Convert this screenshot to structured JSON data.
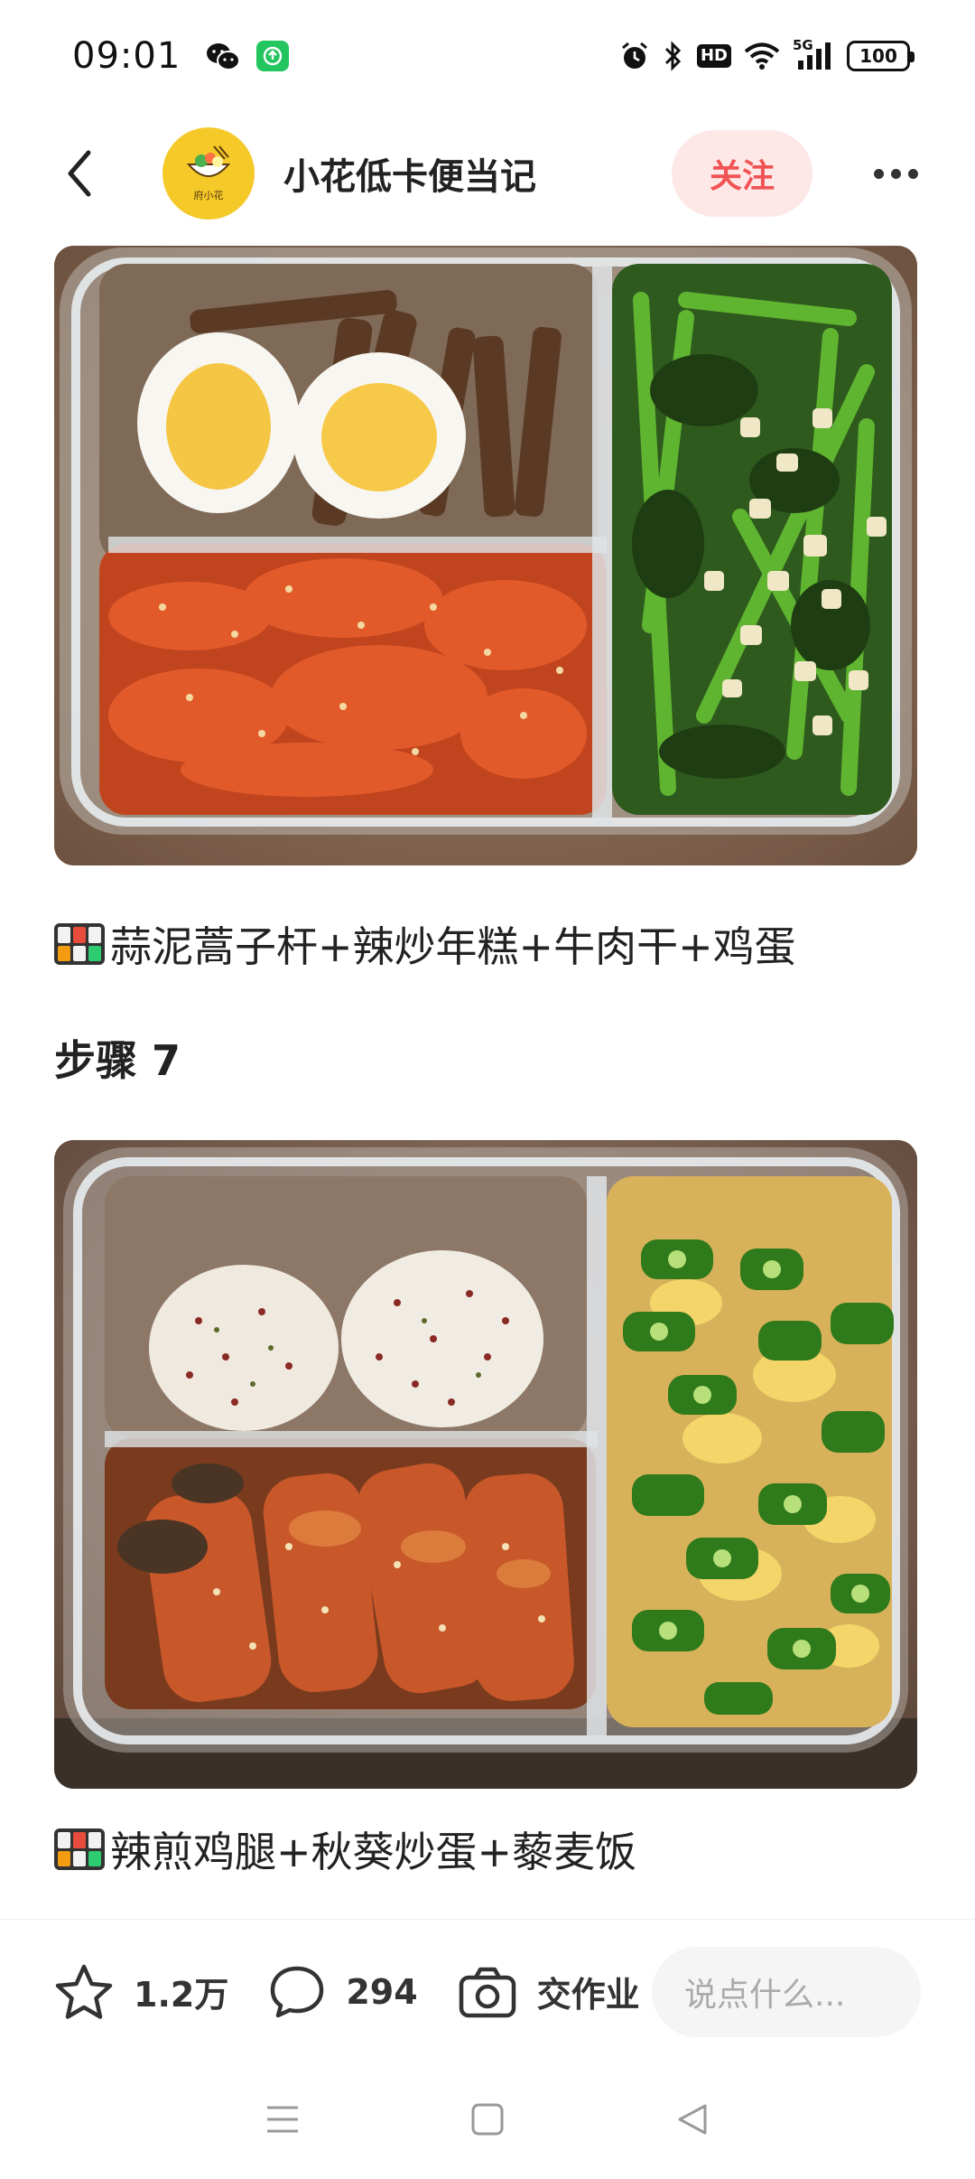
{
  "status_bar": {
    "time": "09:01",
    "network": "5G",
    "hd": "HD",
    "battery": "100"
  },
  "header": {
    "author": "小花低卡便当记",
    "avatar_text": "府小花",
    "follow_label": "关注"
  },
  "content": {
    "caption_1": "蒜泥蒿子杆+辣炒年糕+牛肉干+鸡蛋",
    "step_title": "步骤 7",
    "caption_2": "辣煎鸡腿+秋葵炒蛋+藜麦饭"
  },
  "action_bar": {
    "favorites": "1.2万",
    "comments": "294",
    "homework_label": "交作业",
    "comment_placeholder": "说点什么..."
  },
  "colors": {
    "accent": "#f05353",
    "follow_bg": "#fde8e7",
    "avatar_bg": "#f4c928"
  }
}
